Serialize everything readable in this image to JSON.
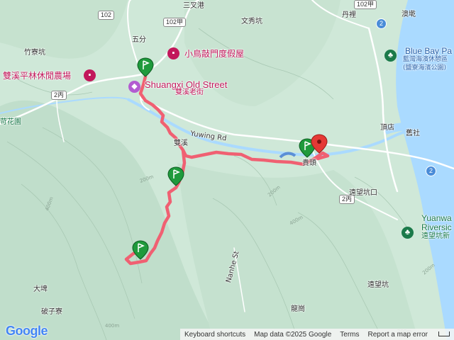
{
  "map": {
    "labels": {
      "sanchagang": "三叉港",
      "wenxiukeng": "文秀坑",
      "danli": "丹裡",
      "aodi": "澳墘",
      "wufen": "五分",
      "zhuliaokeng": "竹寮坑",
      "shuangxi_farm": "雙溪平林休閒農場",
      "xiaoniao": "小鳥敲門度假屋",
      "old_street_en": "Shuangxi Old Street",
      "old_street_zh": "雙溪老街",
      "huayuan": "苛花園",
      "yuwing_rd": "Yuwing Rd",
      "shuangxi": "雙溪",
      "guitou": "貴頭",
      "dingdian": "頂店",
      "jiushe": "舊社",
      "yuanwangkeng_kou": "遠望坑口",
      "bluebay_en": "Blue Bay Pa",
      "bluebay_zh1": "藍灣海濱休憩區",
      "bluebay_zh2": "(鹽寮海濱公園)",
      "yuanwang_en": "Yuanwa",
      "yuanwang_en2": "Riversic",
      "yuanwang_zh": "遠望坑新",
      "nanhe_rd": "Nanhe St",
      "yuanwangkeng": "遠望坑",
      "dapu": "大埤",
      "pozi_liao": "破子寮",
      "longgang": "龍崗"
    },
    "shields": {
      "r102_top": "102",
      "r102a_left": "102甲",
      "r102a_right": "102甲",
      "r2_top": "2",
      "r2_right": "2",
      "r2bing_left": "2丙",
      "r2bing_right": "2丙"
    },
    "contours": [
      "200m",
      "400m",
      "200m",
      "200m",
      "200m",
      "400m",
      "400m"
    ],
    "colors": {
      "route": "#f06072",
      "marker_green": "#1f9a3c",
      "marker_red": "#e53935",
      "water": "#aadaff",
      "terrain": "#cfe8d8",
      "road_white": "#ffffff"
    }
  },
  "google_logo": "Google",
  "attribution": {
    "shortcuts": "Keyboard shortcuts",
    "mapdata": "Map data ©2025 Google",
    "terms": "Terms",
    "report": "Report a map error"
  }
}
